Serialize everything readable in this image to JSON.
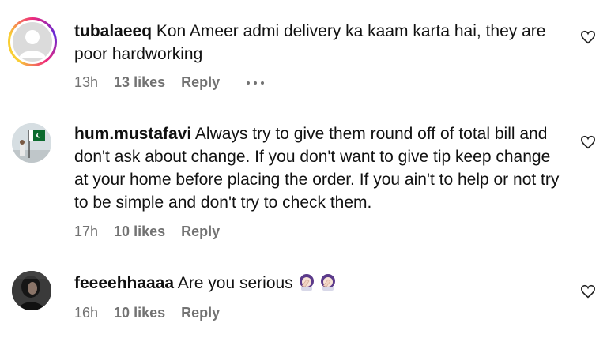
{
  "comments": [
    {
      "username": "tubalaeeq",
      "text": "Kon Ameer admi delivery ka kaam karta hai, they are poor hardworking",
      "time": "13h",
      "likes": "13 likes",
      "reply": "Reply",
      "avatar_icon": "default-avatar-icon",
      "story_ring": true
    },
    {
      "username": "hum.mustafavi",
      "text": "Always try to give them round off of total bill and don't ask about change. If you don't want to give tip keep change at your home before placing the order. If you ain't to help or not try to be simple and don't try to check them.",
      "time": "17h",
      "likes": "10 likes",
      "reply": "Reply",
      "avatar_icon": "flag-photo-avatar"
    },
    {
      "username": "feeeehhaaaa",
      "text": "Are you serious",
      "emoji": [
        "facepalm-woman-emoji",
        "facepalm-woman-emoji"
      ],
      "time": "16h",
      "likes": "10 likes",
      "reply": "Reply",
      "avatar_icon": "dark-photo-avatar"
    }
  ],
  "colors": {
    "text": "#111111",
    "meta": "#737373",
    "ring_start": "#f9ce34",
    "ring_mid": "#ee2a7b",
    "ring_end": "#6228d7"
  }
}
